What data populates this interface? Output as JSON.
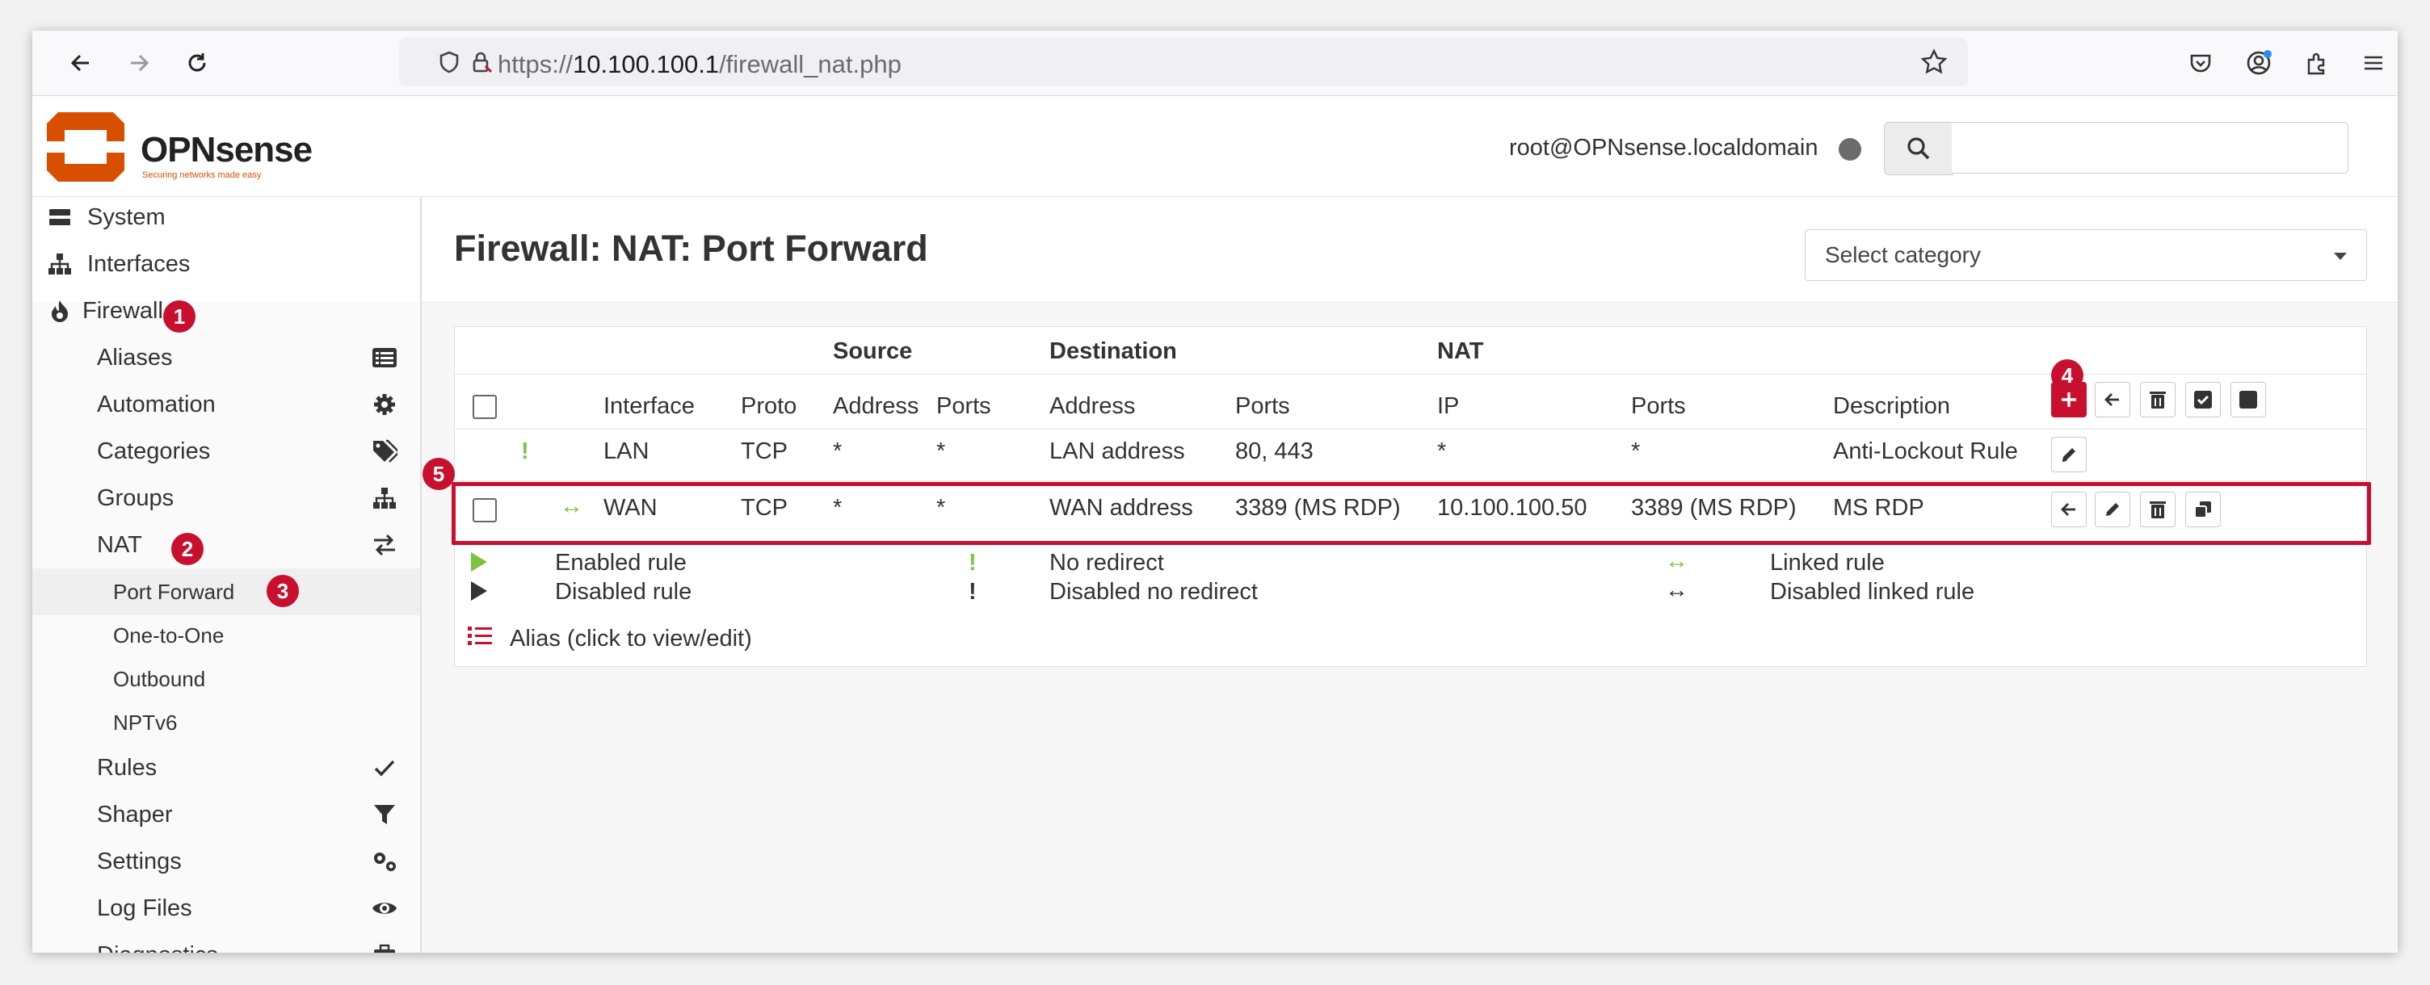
{
  "browser": {
    "url_scheme": "https://",
    "url_host": "10.100.100.1",
    "url_path": "/firewall_nat.php"
  },
  "header": {
    "logo_text": "OPNsense",
    "logo_tagline": "Securing networks made easy",
    "user": "root@OPNsense.localdomain"
  },
  "sidebar": {
    "system": "System",
    "interfaces": "Interfaces",
    "firewall": "Firewall",
    "aliases": "Aliases",
    "automation": "Automation",
    "categories": "Categories",
    "groups": "Groups",
    "nat": "NAT",
    "port_forward": "Port Forward",
    "one_to_one": "One-to-One",
    "outbound": "Outbound",
    "nptv6": "NPTv6",
    "rules": "Rules",
    "shaper": "Shaper",
    "settings": "Settings",
    "log_files": "Log Files",
    "diagnostics": "Diagnostics"
  },
  "badges": [
    "1",
    "2",
    "3",
    "4",
    "5"
  ],
  "page": {
    "title": "Firewall: NAT: Port Forward",
    "category_placeholder": "Select category"
  },
  "table": {
    "group_headers": {
      "source": "Source",
      "destination": "Destination",
      "nat": "NAT"
    },
    "columns": {
      "interface": "Interface",
      "proto": "Proto",
      "src_address": "Address",
      "src_ports": "Ports",
      "dst_address": "Address",
      "dst_ports": "Ports",
      "nat_ip": "IP",
      "nat_ports": "Ports",
      "description": "Description"
    },
    "rows": [
      {
        "flag": "!",
        "interface": "LAN",
        "proto": "TCP",
        "src_address": "*",
        "src_ports": "*",
        "dst_address": "LAN address",
        "dst_ports": "80, 443",
        "nat_ip": "*",
        "nat_ports": "*",
        "description": "Anti-Lockout Rule"
      },
      {
        "flag": "↔",
        "interface": "WAN",
        "proto": "TCP",
        "src_address": "*",
        "src_ports": "*",
        "dst_address": "WAN address",
        "dst_ports": "3389 (MS RDP)",
        "nat_ip": "10.100.100.50",
        "nat_ports": "3389 (MS RDP)",
        "description": "MS RDP"
      }
    ]
  },
  "legend": {
    "enabled_rule": "Enabled rule",
    "disabled_rule": "Disabled rule",
    "no_redirect": "No redirect",
    "disabled_no_redirect": "Disabled no redirect",
    "linked_rule": "Linked rule",
    "disabled_linked_rule": "Disabled linked rule",
    "alias": "Alias (click to view/edit)"
  },
  "colors": {
    "accent_red": "#c8102e",
    "brand_orange": "#d94f00",
    "green": "#7dc243"
  }
}
